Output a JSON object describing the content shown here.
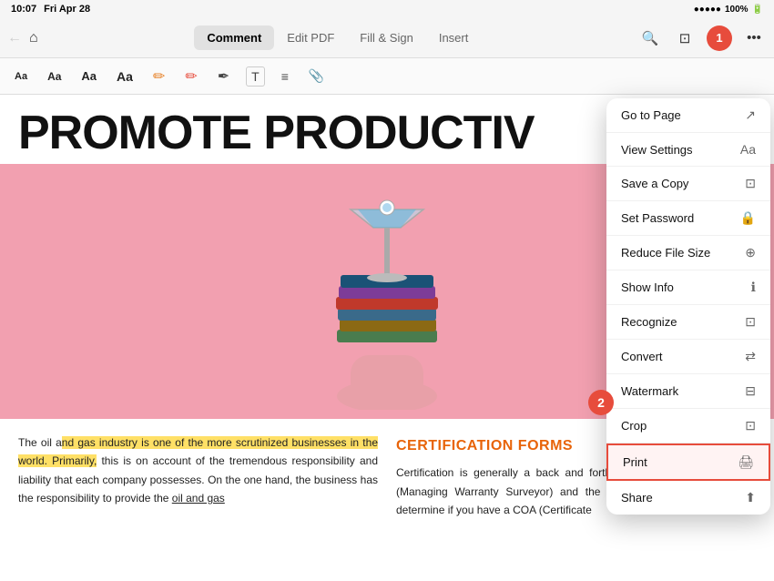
{
  "statusBar": {
    "time": "10:07",
    "day": "Fri Apr 28",
    "battery": "100%",
    "signal": "●●●●●"
  },
  "toolbar": {
    "tabs": [
      {
        "id": "comment",
        "label": "Comment",
        "active": true
      },
      {
        "id": "edit-pdf",
        "label": "Edit PDF",
        "active": false
      },
      {
        "id": "fill-sign",
        "label": "Fill & Sign",
        "active": false
      },
      {
        "id": "insert",
        "label": "Insert",
        "active": false
      }
    ]
  },
  "menu": {
    "items": [
      {
        "id": "go-to-page",
        "label": "Go to Page",
        "icon": "↗"
      },
      {
        "id": "view-settings",
        "label": "View Settings",
        "icon": "Aa"
      },
      {
        "id": "save-a-copy",
        "label": "Save a Copy",
        "icon": "⊡"
      },
      {
        "id": "set-password",
        "label": "Set Password",
        "icon": "🔒"
      },
      {
        "id": "reduce-file-size",
        "label": "Reduce File Size",
        "icon": "⊕"
      },
      {
        "id": "show-info",
        "label": "Show Info",
        "icon": "ℹ"
      },
      {
        "id": "recognize",
        "label": "Recognize",
        "icon": "⊡"
      },
      {
        "id": "convert",
        "label": "Convert",
        "icon": "⇄"
      },
      {
        "id": "watermark",
        "label": "Watermark",
        "icon": "⊟"
      },
      {
        "id": "crop",
        "label": "Crop",
        "icon": "⊡"
      },
      {
        "id": "print",
        "label": "Print",
        "icon": "🖨"
      },
      {
        "id": "share",
        "label": "Share",
        "icon": "⬆"
      }
    ]
  },
  "pdf": {
    "title": "PROMOTE PRODUCTIV",
    "bodyLeft": "The oil and gas industry is one of the more scrutinized businesses in the world. Primarily, this is on account of the tremendous responsibility and liability that each company possesses. On the one hand, the business has the responsibility to provide the oil and gas",
    "colRightTitle": "CERTIFICATION FORMS",
    "bodyRight": "Certification is generally a back and forth of fixes between the MWS (Managing Warranty Surveyor) and the insurer. Since the MWS will determine if you have a COA (Certificate",
    "highlightStart": "nd gas industry is one of the more",
    "underlineText": "oil and gas"
  },
  "stepBadges": [
    {
      "id": "badge-1",
      "label": "1"
    },
    {
      "id": "badge-2",
      "label": "2"
    }
  ]
}
